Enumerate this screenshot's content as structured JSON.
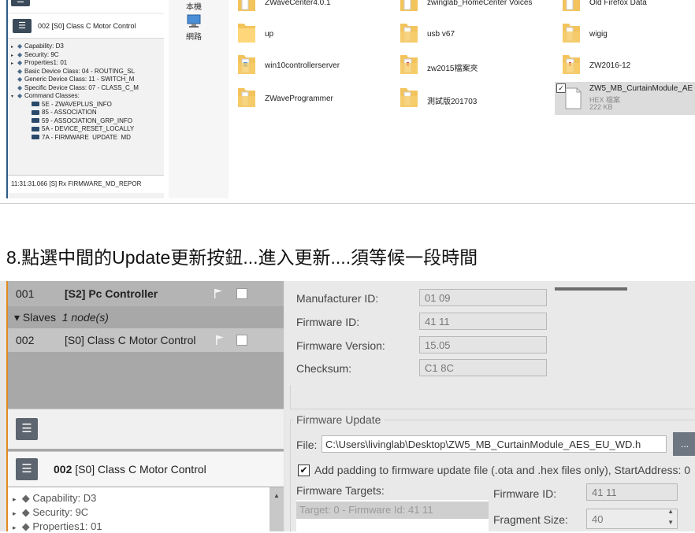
{
  "top": {
    "nav_label_top": "本機",
    "nav_label_network": "網路",
    "node_header": "002 [S0] Class C Motor Control",
    "tree": [
      {
        "text": "Capability: D3",
        "arrow": "▸"
      },
      {
        "text": "Security: 9C",
        "arrow": "▸"
      },
      {
        "text": "Properties1: 01",
        "arrow": "▸"
      },
      {
        "text": "Basic Device Class: 04 - ROUTING_SL",
        "arrow": ""
      },
      {
        "text": "Generic Device Class: 11 - SWITCH_M",
        "arrow": ""
      },
      {
        "text": "Specific Device Class: 07 - CLASS_C_M",
        "arrow": ""
      },
      {
        "text": "Command Classes:",
        "arrow": "▾"
      }
    ],
    "command_classes": [
      "5E - ZWAVEPLUS_INFO",
      "85 - ASSOCIATION",
      "59 - ASSOCIATION_GRP_INFO",
      "5A - DEVICE_RESET_LOCALLY",
      "7A - FIRMWARE_UPDATE_MD"
    ],
    "log_line": "11:31:31.066 [S] Rx FIRMWARE_MD_REPOR",
    "files": {
      "row0": [
        "ZWaveCenter4.0.1",
        "zwinglab_HomeCenter Voices",
        "Old Firefox Data"
      ],
      "row1": [
        "up",
        "usb v67",
        "wigig"
      ],
      "row2": [
        "win10controllerserver",
        "zw2015檔案夾",
        "ZW2016-12"
      ],
      "row3": [
        "ZWaveProgrammer",
        "測試版201703"
      ],
      "selected": {
        "name": "ZW5_MB_CurtainModule_AE",
        "type": "HEX 檔案",
        "size": "222 KB"
      }
    }
  },
  "caption": "8.點選中間的Update更新按鈕...進入更新....須等候一段時間",
  "bottom": {
    "node_list": [
      {
        "id": "001",
        "name": "[S2] Pc Controller"
      },
      {
        "id": "002",
        "name": "[S0] Class C Motor Control"
      }
    ],
    "slaves_label": "Slaves",
    "slaves_count": "1 node(s)",
    "node_header_id": "002",
    "node_header_name": "[S0] Class C Motor Control",
    "tree": [
      "Capability: D3",
      "Security: 9C",
      "Properties1: 01"
    ],
    "info": {
      "manufacturer_label": "Manufacturer ID:",
      "manufacturer_value": "01 09",
      "firmware_id_label": "Firmware ID:",
      "firmware_id_value": "41 11",
      "firmware_version_label": "Firmware Version:",
      "firmware_version_value": "15.05",
      "checksum_label": "Checksum:",
      "checksum_value": "C1 8C"
    },
    "update": {
      "group_title": "Firmware Update",
      "file_label": "File:",
      "file_path": "C:\\Users\\livinglab\\Desktop\\ZW5_MB_CurtainModule_AES_EU_WD.h",
      "browse_label": "...",
      "padding_text": "Add padding to firmware update file (.ota and .hex files only), StartAddress: 0",
      "targets_label": "Firmware Targets:",
      "target_item": "Target: 0 - Firmware Id: 41 11",
      "fw_id_label": "Firmware ID:",
      "fw_id_value": "41 11",
      "fragment_label": "Fragment Size:",
      "fragment_value": "40"
    }
  }
}
